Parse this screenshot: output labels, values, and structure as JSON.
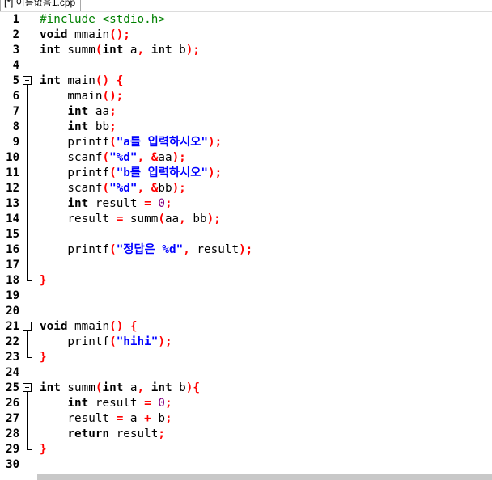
{
  "tab": {
    "title": "[*] 이름없음1.cpp"
  },
  "colors": {
    "keyword": "#000000",
    "preprocessor": "#008000",
    "symbol": "#ff0000",
    "string": "#0000ff",
    "number": "#800080"
  },
  "lines": [
    {
      "n": "1",
      "fold": "",
      "tokens": [
        [
          "pp",
          "#include <stdio.h>"
        ]
      ]
    },
    {
      "n": "2",
      "fold": "",
      "tokens": [
        [
          "kw",
          "void"
        ],
        [
          "id",
          " mmain"
        ],
        [
          "sym",
          "();"
        ]
      ]
    },
    {
      "n": "3",
      "fold": "",
      "tokens": [
        [
          "kw",
          "int"
        ],
        [
          "id",
          " summ"
        ],
        [
          "sym",
          "("
        ],
        [
          "kw",
          "int"
        ],
        [
          "id",
          " a"
        ],
        [
          "sym",
          ","
        ],
        [
          "id",
          " "
        ],
        [
          "kw",
          "int"
        ],
        [
          "id",
          " b"
        ],
        [
          "sym",
          ");"
        ]
      ]
    },
    {
      "n": "4",
      "fold": "",
      "tokens": []
    },
    {
      "n": "5",
      "fold": "start",
      "tokens": [
        [
          "kw",
          "int"
        ],
        [
          "id",
          " main"
        ],
        [
          "sym",
          "()"
        ],
        [
          "id",
          " "
        ],
        [
          "sym",
          "{"
        ]
      ]
    },
    {
      "n": "6",
      "fold": "line",
      "tokens": [
        [
          "id",
          "    mmain"
        ],
        [
          "sym",
          "();"
        ]
      ]
    },
    {
      "n": "7",
      "fold": "line",
      "tokens": [
        [
          "id",
          "    "
        ],
        [
          "kw",
          "int"
        ],
        [
          "id",
          " aa"
        ],
        [
          "sym",
          ";"
        ]
      ]
    },
    {
      "n": "8",
      "fold": "line",
      "tokens": [
        [
          "id",
          "    "
        ],
        [
          "kw",
          "int"
        ],
        [
          "id",
          " bb"
        ],
        [
          "sym",
          ";"
        ]
      ]
    },
    {
      "n": "9",
      "fold": "line",
      "tokens": [
        [
          "id",
          "    printf"
        ],
        [
          "sym",
          "("
        ],
        [
          "str",
          "\"a를 입력하시오\""
        ],
        [
          "sym",
          ");"
        ]
      ]
    },
    {
      "n": "10",
      "fold": "line",
      "tokens": [
        [
          "id",
          "    scanf"
        ],
        [
          "sym",
          "("
        ],
        [
          "str",
          "\"%d\""
        ],
        [
          "sym",
          ","
        ],
        [
          "id",
          " "
        ],
        [
          "sym",
          "&"
        ],
        [
          "id",
          "aa"
        ],
        [
          "sym",
          ");"
        ]
      ]
    },
    {
      "n": "11",
      "fold": "line",
      "tokens": [
        [
          "id",
          "    printf"
        ],
        [
          "sym",
          "("
        ],
        [
          "str",
          "\"b를 입력하시오\""
        ],
        [
          "sym",
          ");"
        ]
      ]
    },
    {
      "n": "12",
      "fold": "line",
      "tokens": [
        [
          "id",
          "    scanf"
        ],
        [
          "sym",
          "("
        ],
        [
          "str",
          "\"%d\""
        ],
        [
          "sym",
          ","
        ],
        [
          "id",
          " "
        ],
        [
          "sym",
          "&"
        ],
        [
          "id",
          "bb"
        ],
        [
          "sym",
          ");"
        ]
      ]
    },
    {
      "n": "13",
      "fold": "line",
      "tokens": [
        [
          "id",
          "    "
        ],
        [
          "kw",
          "int"
        ],
        [
          "id",
          " result "
        ],
        [
          "sym",
          "="
        ],
        [
          "id",
          " "
        ],
        [
          "num",
          "0"
        ],
        [
          "sym",
          ";"
        ]
      ]
    },
    {
      "n": "14",
      "fold": "line",
      "tokens": [
        [
          "id",
          "    result "
        ],
        [
          "sym",
          "="
        ],
        [
          "id",
          " summ"
        ],
        [
          "sym",
          "("
        ],
        [
          "id",
          "aa"
        ],
        [
          "sym",
          ","
        ],
        [
          "id",
          " bb"
        ],
        [
          "sym",
          ");"
        ]
      ]
    },
    {
      "n": "15",
      "fold": "line",
      "tokens": []
    },
    {
      "n": "16",
      "fold": "line",
      "tokens": [
        [
          "id",
          "    printf"
        ],
        [
          "sym",
          "("
        ],
        [
          "str",
          "\"정답은 %d\""
        ],
        [
          "sym",
          ","
        ],
        [
          "id",
          " result"
        ],
        [
          "sym",
          ");"
        ]
      ]
    },
    {
      "n": "17",
      "fold": "line",
      "tokens": []
    },
    {
      "n": "18",
      "fold": "end",
      "tokens": [
        [
          "sym",
          "}"
        ]
      ]
    },
    {
      "n": "19",
      "fold": "",
      "tokens": []
    },
    {
      "n": "20",
      "fold": "",
      "tokens": []
    },
    {
      "n": "21",
      "fold": "start",
      "tokens": [
        [
          "kw",
          "void"
        ],
        [
          "id",
          " mmain"
        ],
        [
          "sym",
          "()"
        ],
        [
          "id",
          " "
        ],
        [
          "sym",
          "{"
        ]
      ]
    },
    {
      "n": "22",
      "fold": "line",
      "tokens": [
        [
          "id",
          "    printf"
        ],
        [
          "sym",
          "("
        ],
        [
          "str",
          "\"hihi\""
        ],
        [
          "sym",
          ");"
        ]
      ]
    },
    {
      "n": "23",
      "fold": "end",
      "tokens": [
        [
          "sym",
          "}"
        ]
      ]
    },
    {
      "n": "24",
      "fold": "",
      "tokens": []
    },
    {
      "n": "25",
      "fold": "start",
      "tokens": [
        [
          "kw",
          "int"
        ],
        [
          "id",
          " summ"
        ],
        [
          "sym",
          "("
        ],
        [
          "kw",
          "int"
        ],
        [
          "id",
          " a"
        ],
        [
          "sym",
          ","
        ],
        [
          "id",
          " "
        ],
        [
          "kw",
          "int"
        ],
        [
          "id",
          " b"
        ],
        [
          "sym",
          "){"
        ]
      ]
    },
    {
      "n": "26",
      "fold": "line",
      "tokens": [
        [
          "id",
          "    "
        ],
        [
          "kw",
          "int"
        ],
        [
          "id",
          " result "
        ],
        [
          "sym",
          "="
        ],
        [
          "id",
          " "
        ],
        [
          "num",
          "0"
        ],
        [
          "sym",
          ";"
        ]
      ]
    },
    {
      "n": "27",
      "fold": "line",
      "tokens": [
        [
          "id",
          "    result "
        ],
        [
          "sym",
          "="
        ],
        [
          "id",
          " a "
        ],
        [
          "sym",
          "+"
        ],
        [
          "id",
          " b"
        ],
        [
          "sym",
          ";"
        ]
      ]
    },
    {
      "n": "28",
      "fold": "line",
      "tokens": [
        [
          "id",
          "    "
        ],
        [
          "kw",
          "return"
        ],
        [
          "id",
          " result"
        ],
        [
          "sym",
          ";"
        ]
      ]
    },
    {
      "n": "29",
      "fold": "end",
      "tokens": [
        [
          "sym",
          "}"
        ]
      ]
    },
    {
      "n": "30",
      "fold": "",
      "tokens": []
    }
  ]
}
